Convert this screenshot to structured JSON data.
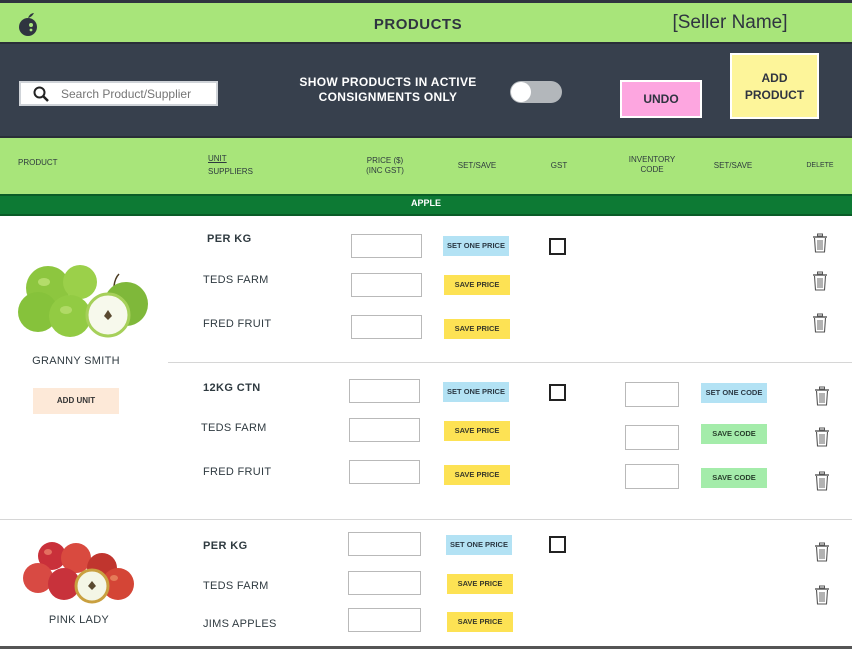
{
  "header": {
    "title": "PRODUCTS",
    "seller": "[Seller Name]",
    "logo_icon": "apple-logo-icon"
  },
  "toolbar": {
    "search_placeholder": "Search Product/Supplier",
    "toggle_label_line1": "SHOW PRODUCTS IN ACTIVE",
    "toggle_label_line2": "CONSIGNMENTS ONLY",
    "toggle_on": false,
    "undo_label": "UNDO",
    "add_product_line1": "ADD",
    "add_product_line2": "PRODUCT"
  },
  "columns": {
    "product": "PRODUCT",
    "unit": "UNIT",
    "suppliers": "SUPPLIERS",
    "price_line1": "PRICE ($)",
    "price_line2": "(INC GST)",
    "set_save": "SET/SAVE",
    "gst": "GST",
    "inventory_line1": "INVENTORY",
    "inventory_line2": "CODE",
    "set_save2": "SET/SAVE",
    "delete": "DELETE"
  },
  "group": {
    "name": "APPLE"
  },
  "products": [
    {
      "name": "GRANNY SMITH",
      "add_unit": "ADD UNIT",
      "units": [
        {
          "unit": "PER KG",
          "set_price": "SET ONE PRICE",
          "suppliers": [
            {
              "name": "TEDS FARM",
              "save_price": "SAVE PRICE"
            },
            {
              "name": "FRED FRUIT",
              "save_price": "SAVE PRICE"
            }
          ]
        },
        {
          "unit": "12KG CTN",
          "set_price": "SET ONE PRICE",
          "set_code": "SET ONE CODE",
          "suppliers": [
            {
              "name": "TEDS FARM",
              "save_price": "SAVE PRICE",
              "save_code": "SAVE CODE"
            },
            {
              "name": "FRED FRUIT",
              "save_price": "SAVE PRICE",
              "save_code": "SAVE CODE"
            }
          ]
        }
      ]
    },
    {
      "name": "PINK LADY",
      "units": [
        {
          "unit": "PER KG",
          "set_price": "SET ONE PRICE",
          "suppliers": [
            {
              "name": "TEDS FARM",
              "save_price": "SAVE PRICE"
            },
            {
              "name": "JIMS APPLES",
              "save_price": "SAVE PRICE"
            }
          ]
        }
      ]
    }
  ],
  "colors": {
    "header_green": "#a8e57a",
    "toolbar": "#37404d",
    "group_green": "#0d7a34",
    "undo_pink": "#fda6e0",
    "add_yellow": "#fdf59a"
  }
}
